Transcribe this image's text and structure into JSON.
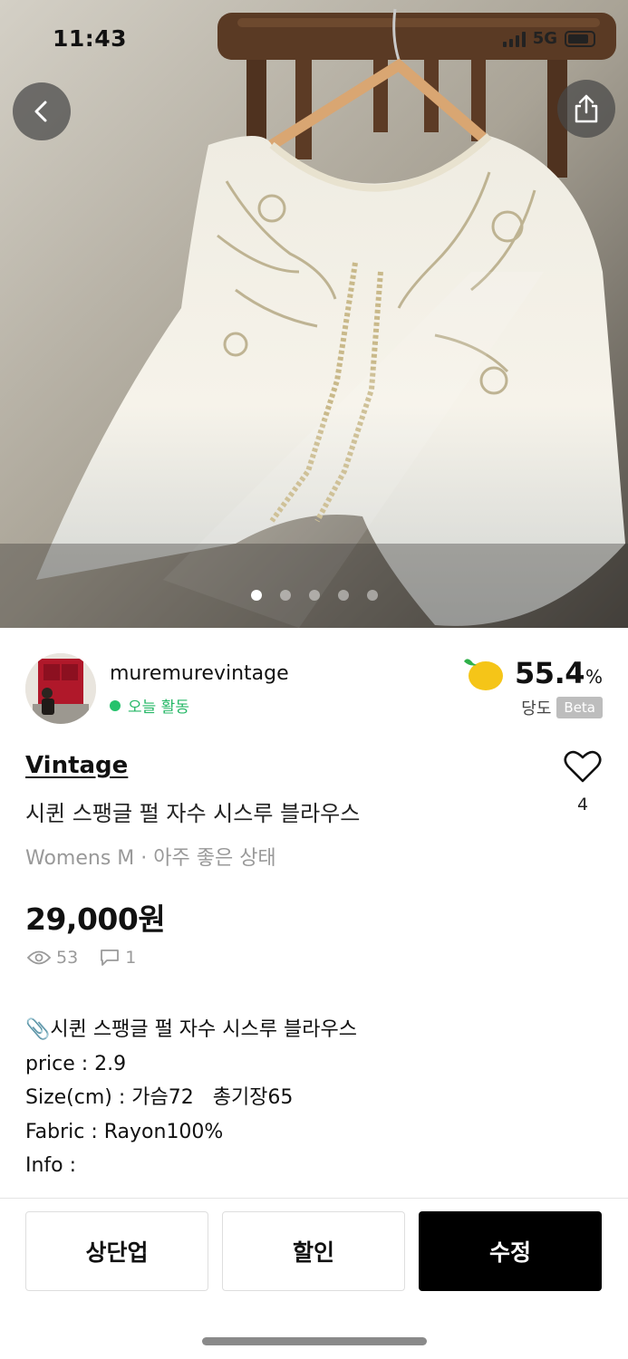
{
  "status_bar": {
    "time": "11:43",
    "network": "5G"
  },
  "photo": {
    "page_indicator": {
      "count": 5,
      "active": 1
    },
    "back_icon": "chevron-left-icon",
    "share_icon": "share-icon"
  },
  "seller": {
    "name": "muremurevintage",
    "activity": "오늘 활동",
    "activity_color": "#25c26c"
  },
  "sweetness": {
    "value": "55.4",
    "unit": "%",
    "label": "당도",
    "badge": "Beta",
    "icon": "lemon-icon"
  },
  "product": {
    "brand": "Vintage",
    "title": "시퀸 스팽글 펄 자수 시스루 블라우스",
    "meta": "Womens M · 아주 좋은 상태",
    "price": "29,000원",
    "views": "53",
    "comments": "1",
    "likes": "4"
  },
  "description": {
    "lines": [
      "📎시퀸 스팽글 펄 자수 시스루 블라우스",
      "price : 2.9",
      "Size(cm) : 가슴72   총기장65",
      "Fabric : Rayon100%",
      "Info :"
    ]
  },
  "actions": {
    "bump_label": "상단업",
    "discount_label": "할인",
    "edit_label": "수정"
  }
}
